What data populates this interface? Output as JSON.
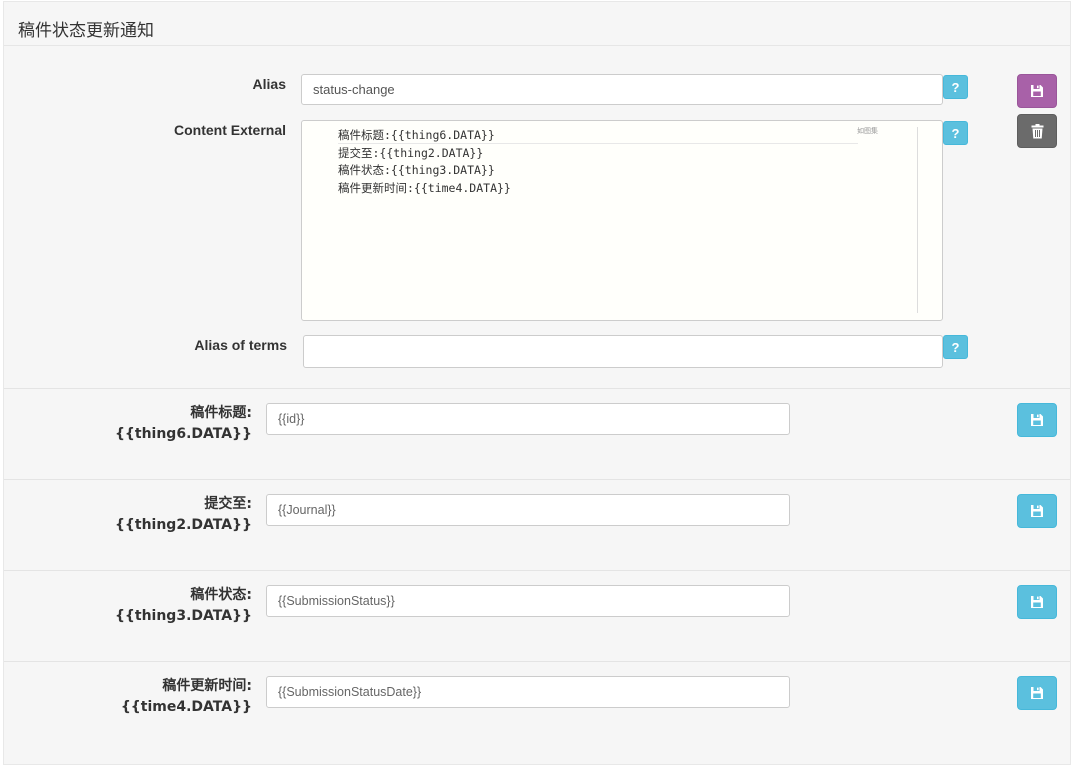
{
  "panel": {
    "title": "稿件状态更新通知"
  },
  "form": {
    "alias": {
      "label": "Alias",
      "value": "status-change"
    },
    "content_external": {
      "label": "Content External",
      "lines": [
        "稿件标题:{{thing6.DATA}}",
        "提交至:{{thing2.DATA}}",
        "稿件状态:{{thing3.DATA}}",
        "稿件更新时间:{{time4.DATA}}"
      ],
      "minimap_label": "如图集"
    },
    "alias_of_terms": {
      "label": "Alias of terms",
      "value": ""
    },
    "help_label": "?"
  },
  "fields": [
    {
      "label_line1": "稿件标题:",
      "label_line2": "{{thing6.DATA}}",
      "value": "{{id}}"
    },
    {
      "label_line1": "提交至:",
      "label_line2": "{{thing2.DATA}}",
      "value": "{{Journal}}"
    },
    {
      "label_line1": "稿件状态:",
      "label_line2": "{{thing3.DATA}}",
      "value": "{{SubmissionStatus}}"
    },
    {
      "label_line1": "稿件更新时间:",
      "label_line2": "{{time4.DATA}}",
      "value": "{{SubmissionStatusDate}}"
    }
  ],
  "icons": {
    "save": "floppy-disk-icon",
    "delete": "trash-icon",
    "help": "question-mark-icon"
  },
  "colors": {
    "save_primary": "#a861a8",
    "delete": "#6b6b6b",
    "info": "#5bc0de",
    "panel_bg": "#f6f6f6"
  }
}
